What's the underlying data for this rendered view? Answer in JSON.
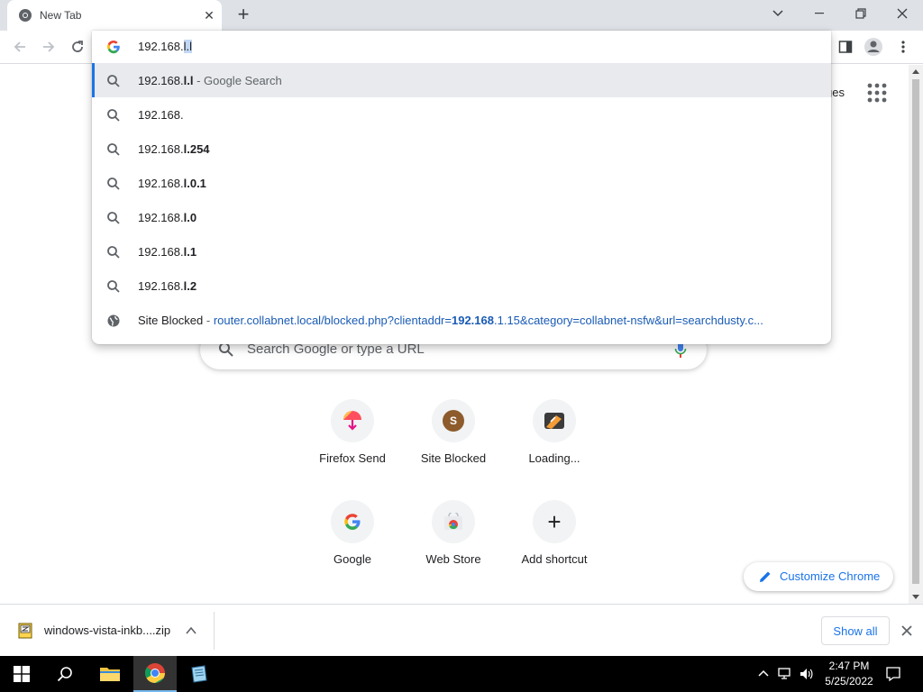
{
  "browser": {
    "tab": {
      "title": "New Tab",
      "close": "✕"
    },
    "new_tab": "+",
    "window": {
      "minimize": "minimize",
      "restore": "restore",
      "close": "close"
    }
  },
  "omnibox": {
    "typed": "192.168.",
    "selected": "l.l",
    "suggestions": [
      {
        "prefix": "192.168.",
        "bold": "l.l",
        "suffix": " - Google Search",
        "type": "search",
        "active": true
      },
      {
        "prefix": "192.168.",
        "bold": "",
        "suffix": "",
        "type": "search",
        "active": false
      },
      {
        "prefix": "192.168.",
        "bold": "l.254",
        "suffix": "",
        "type": "search",
        "active": false
      },
      {
        "prefix": "192.168.",
        "bold": "l.0.1",
        "suffix": "",
        "type": "search",
        "active": false
      },
      {
        "prefix": "192.168.",
        "bold": "l.0",
        "suffix": "",
        "type": "search",
        "active": false
      },
      {
        "prefix": "192.168.",
        "bold": "l.1",
        "suffix": "",
        "type": "search",
        "active": false
      },
      {
        "prefix": "192.168.",
        "bold": "l.2",
        "suffix": "",
        "type": "search",
        "active": false
      }
    ],
    "history_item": {
      "title": "Site Blocked",
      "dash": " - ",
      "url_pre": "router.collabnet.local/blocked.php?clientaddr=",
      "url_bold": "192.168",
      "url_post": ".1.15&category=collabnet-nsfw&url=searchdusty.c..."
    }
  },
  "ntp": {
    "images_link": "ges",
    "search_placeholder": "Search Google or type a URL",
    "tiles": [
      {
        "label": "Firefox Send",
        "icon": "firefox-send-icon"
      },
      {
        "label": "Site Blocked",
        "icon": "site-blocked-icon",
        "letter": "S"
      },
      {
        "label": "Loading...",
        "icon": "loading-site-icon"
      },
      {
        "label": "Google",
        "icon": "google-icon"
      },
      {
        "label": "Web Store",
        "icon": "web-store-icon"
      },
      {
        "label": "Add shortcut",
        "icon": "add-icon",
        "glyph": "+"
      }
    ],
    "customize": "Customize Chrome"
  },
  "downloads": {
    "file": "windows-vista-inkb....zip",
    "show_all": "Show all"
  },
  "taskbar": {
    "time": "2:47 PM",
    "date": "5/25/2022"
  },
  "colors": {
    "accent": "#1a73e8",
    "tabstrip": "#dee1e6",
    "taskbar": "#000000"
  }
}
